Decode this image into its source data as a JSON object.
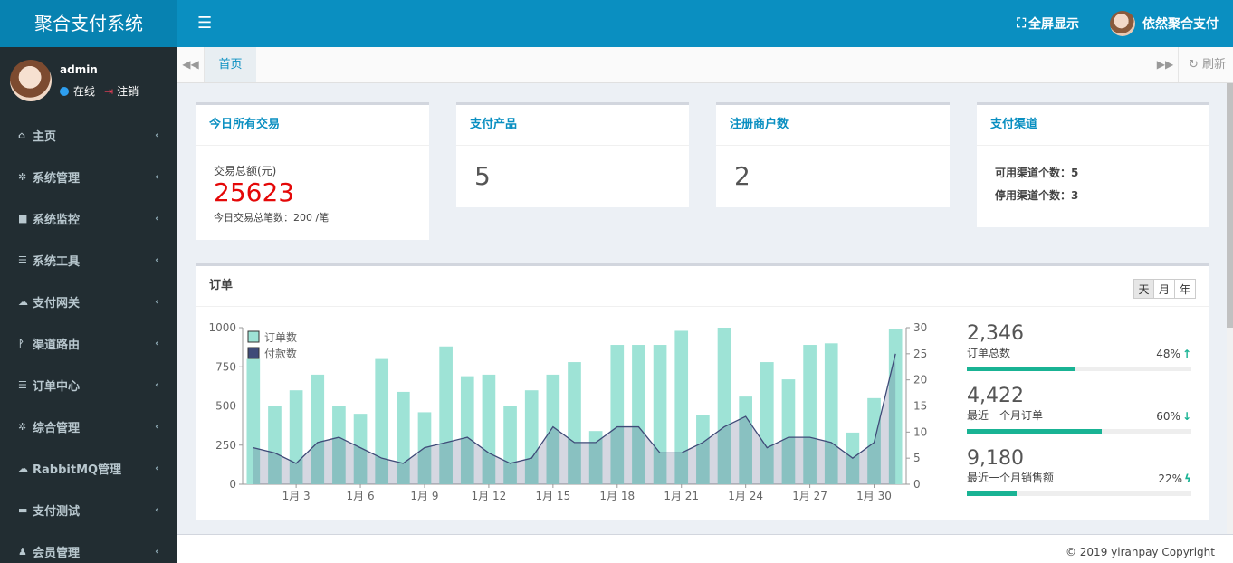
{
  "app": {
    "title": "聚合支付系统"
  },
  "header": {
    "fullscreen_label": "全屏显示",
    "username": "依然聚合支付",
    "menu_icon": "hamburger-icon"
  },
  "user_panel": {
    "name": "admin",
    "status": "在线",
    "logout": "注销"
  },
  "sidebar": {
    "items": [
      {
        "label": "主页",
        "icon": "home-icon",
        "glyph": "⌂"
      },
      {
        "label": "系统管理",
        "icon": "gear-icon",
        "glyph": "✲"
      },
      {
        "label": "系统监控",
        "icon": "video-camera-icon",
        "glyph": "■"
      },
      {
        "label": "系统工具",
        "icon": "list-icon",
        "glyph": "☰"
      },
      {
        "label": "支付网关",
        "icon": "cloud-icon",
        "glyph": "☁"
      },
      {
        "label": "渠道路由",
        "icon": "route-icon",
        "glyph": "ᚹ"
      },
      {
        "label": "订单中心",
        "icon": "list-icon",
        "glyph": "☰"
      },
      {
        "label": "综合管理",
        "icon": "gears-icon",
        "glyph": "✲"
      },
      {
        "label": "RabbitMQ管理",
        "icon": "cloud-icon",
        "glyph": "☁"
      },
      {
        "label": "支付测试",
        "icon": "credit-card-icon",
        "glyph": "▬"
      },
      {
        "label": "会员管理",
        "icon": "user-icon",
        "glyph": "♟"
      }
    ]
  },
  "tabs": {
    "home": "首页",
    "refresh": "刷新"
  },
  "stats": {
    "today": {
      "title": "今日所有交易",
      "amount_label": "交易总额(元)",
      "amount": "25623",
      "count_text": "今日交易总笔数：200 /笔"
    },
    "products": {
      "title": "支付产品",
      "value": "5"
    },
    "merchants": {
      "title": "注册商户数",
      "value": "2"
    },
    "channels": {
      "title": "支付渠道",
      "available": "可用渠道个数：5",
      "disabled": "停用渠道个数：3"
    }
  },
  "orders": {
    "title": "订单",
    "periods": [
      "天",
      "月",
      "年"
    ],
    "active_period": "天",
    "kpis": [
      {
        "value": "2,346",
        "label": "订单总数",
        "percent": "48%",
        "arrow": "↑",
        "fill": 0.48
      },
      {
        "value": "4,422",
        "label": "最近一个月订单",
        "percent": "60%",
        "arrow": "↓",
        "fill": 0.6
      },
      {
        "value": "9,180",
        "label": "最近一个月销售额",
        "percent": "22%",
        "arrow": "ϟ",
        "fill": 0.22
      }
    ]
  },
  "chart_data": {
    "type": "bar",
    "categories": [
      "1月 1",
      "1月 2",
      "1月 3",
      "1月 4",
      "1月 5",
      "1月 6",
      "1月 7",
      "1月 8",
      "1月 9",
      "1月 10",
      "1月 11",
      "1月 12",
      "1月 13",
      "1月 14",
      "1月 15",
      "1月 16",
      "1月 17",
      "1月 18",
      "1月 19",
      "1月 20",
      "1月 21",
      "1月 22",
      "1月 23",
      "1月 24",
      "1月 25",
      "1月 26",
      "1月 27",
      "1月 28",
      "1月 29",
      "1月 30",
      "1月 31"
    ],
    "x_tick_labels": [
      "1月 3",
      "1月 6",
      "1月 9",
      "1月 12",
      "1月 15",
      "1月 18",
      "1月 21",
      "1月 24",
      "1月 27",
      "1月 30"
    ],
    "x_tick_indices": [
      2,
      5,
      8,
      11,
      14,
      17,
      20,
      23,
      26,
      29
    ],
    "series": [
      {
        "name": "订单数",
        "kind": "bar",
        "axis": "left",
        "color": "#9ee3d6",
        "values": [
          800,
          500,
          600,
          700,
          500,
          450,
          800,
          590,
          460,
          880,
          690,
          700,
          500,
          600,
          700,
          780,
          340,
          890,
          890,
          890,
          980,
          440,
          1000,
          560,
          780,
          670,
          890,
          900,
          330,
          550,
          990
        ]
      },
      {
        "name": "付款数",
        "kind": "area",
        "axis": "right",
        "color": "#3f4b78",
        "values": [
          7,
          6,
          4,
          8,
          9,
          7,
          5,
          4,
          7,
          8,
          9,
          6,
          4,
          5,
          11,
          8,
          8,
          11,
          11,
          6,
          6,
          8,
          11,
          13,
          7,
          9,
          9,
          8,
          5,
          8,
          25
        ]
      }
    ],
    "ylim_left": [
      0,
      1000
    ],
    "yticks_left": [
      0,
      250,
      500,
      750,
      1000
    ],
    "ylim_right": [
      0,
      30
    ],
    "yticks_right": [
      0,
      5,
      10,
      15,
      20,
      25,
      30
    ],
    "legend_position": "top-left"
  },
  "footer": {
    "copyright": "© 2019 yiranpay Copyright"
  }
}
